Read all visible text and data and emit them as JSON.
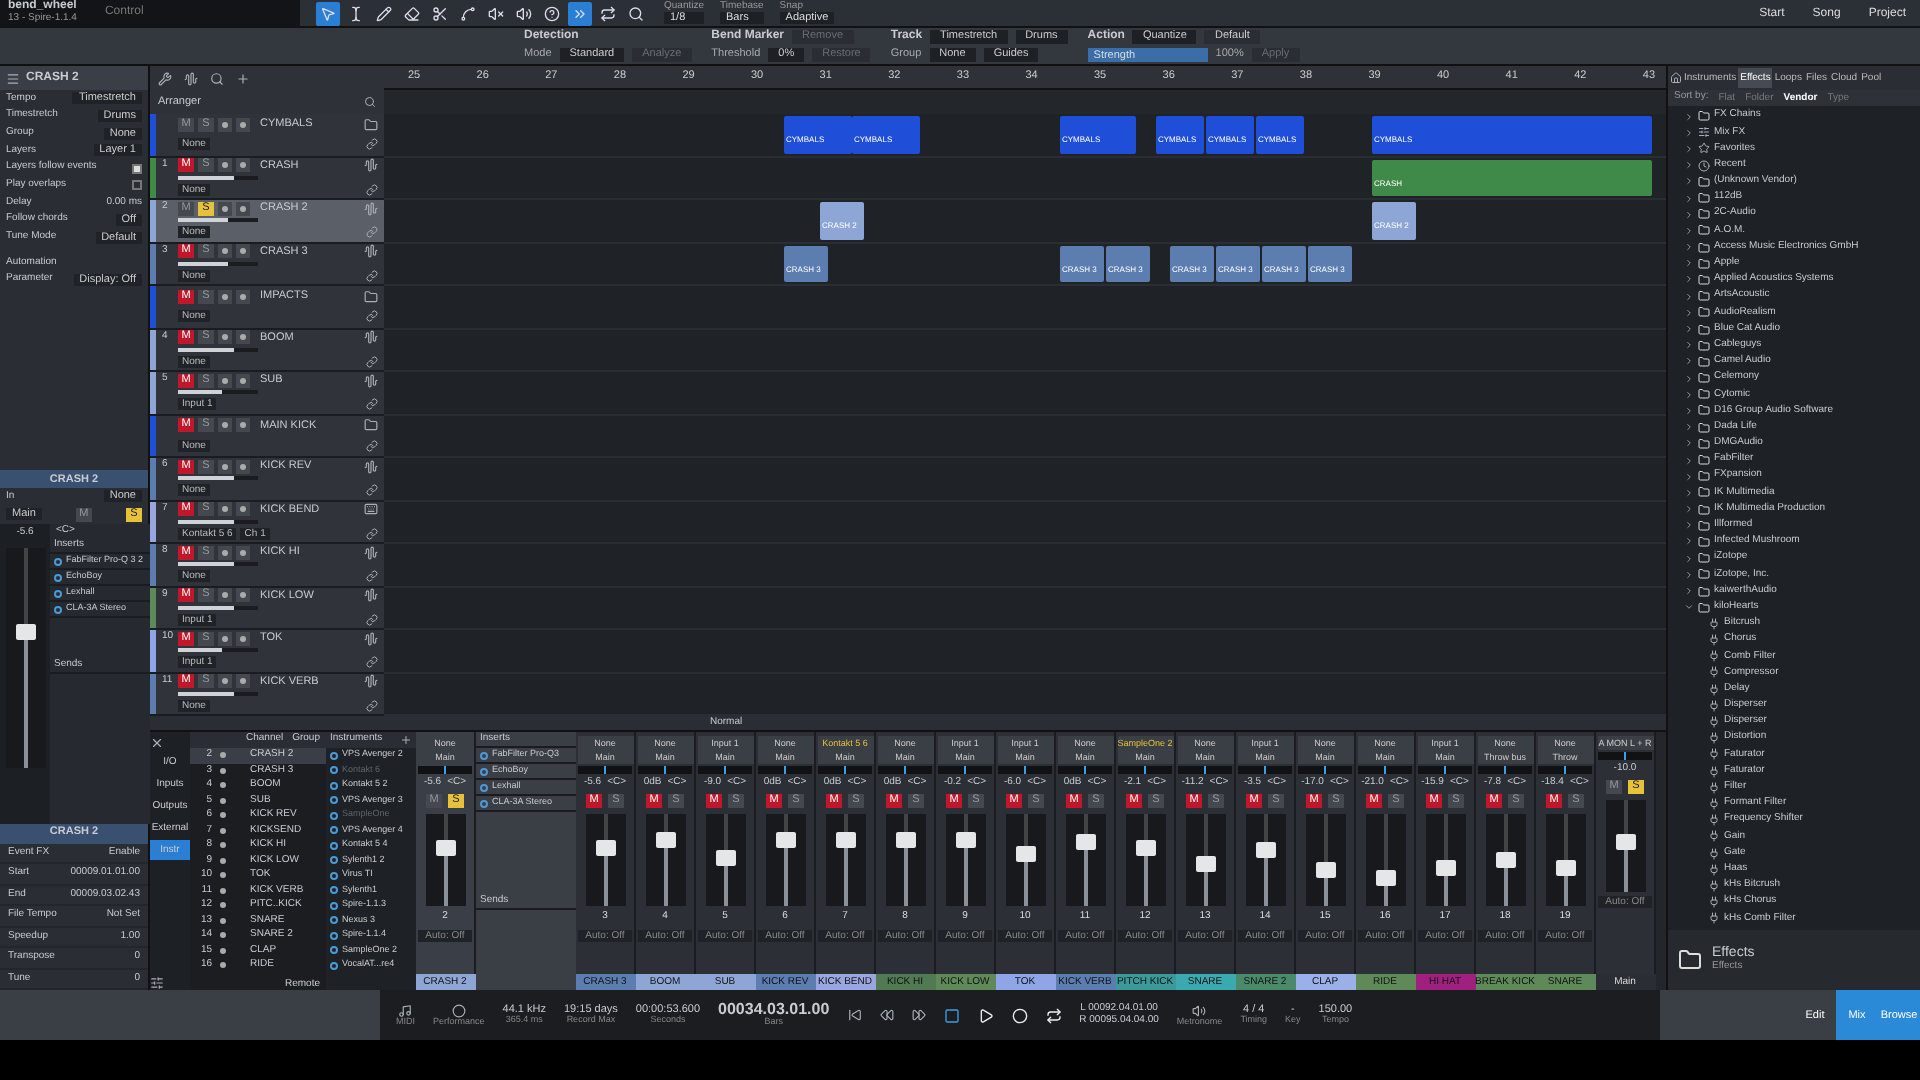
{
  "toolbar": {
    "song_title": "bend_wheel",
    "instrument": "13 - Spire-1.1.4",
    "control": "Control",
    "tools": [
      {
        "kind": "pointer",
        "selected": true
      },
      {
        "kind": "range",
        "selected": false
      },
      {
        "kind": "pencil",
        "selected": false
      },
      {
        "kind": "eraser",
        "selected": false
      },
      {
        "kind": "split",
        "selected": false
      },
      {
        "kind": "bend",
        "selected": false
      },
      {
        "kind": "mute",
        "selected": false
      },
      {
        "kind": "listen",
        "selected": false
      },
      {
        "kind": "help",
        "selected": false
      },
      {
        "kind": "autoscroll",
        "selected": true
      },
      {
        "kind": "loop",
        "selected": false
      },
      {
        "kind": "zoom",
        "selected": false
      }
    ],
    "settings": [
      {
        "label": "Quantize",
        "value": "1/8"
      },
      {
        "label": "Timebase",
        "value": "Bars"
      },
      {
        "label": "Snap",
        "value": "Adaptive"
      }
    ],
    "buttons": [
      "Start",
      "Song",
      "Project"
    ]
  },
  "bend_panel": [
    {
      "title": "Detection",
      "row2": [
        {
          "kind": "text",
          "text": "Mode"
        },
        {
          "kind": "dropdown",
          "text": "Standard"
        },
        {
          "kind": "button",
          "text": "Analyze",
          "disabled": true
        }
      ]
    },
    {
      "title": "Bend Marker",
      "row1": [
        {
          "kind": "button",
          "text": "Remove",
          "disabled": true
        }
      ],
      "row2": [
        {
          "kind": "text",
          "text": "Threshold"
        },
        {
          "kind": "dropdown",
          "text": "0%"
        },
        {
          "kind": "button",
          "text": "Restore",
          "disabled": true
        }
      ]
    },
    {
      "title": "Track",
      "row1": [
        {
          "kind": "dropdown",
          "text": "Timestretch"
        },
        {
          "kind": "dropdown",
          "text": "Drums"
        }
      ],
      "row2": [
        {
          "kind": "text",
          "text": "Group"
        },
        {
          "kind": "dropdown",
          "text": "None"
        },
        {
          "kind": "dropdown",
          "text": "Guides"
        }
      ]
    },
    {
      "title": "Action",
      "row1": [
        {
          "kind": "dropdown",
          "text": "Quantize"
        },
        {
          "kind": "button",
          "text": "Default",
          "disabled": false
        }
      ],
      "row2": [
        {
          "kind": "slider",
          "text": "Strength",
          "level": 1
        },
        {
          "kind": "text",
          "text": "100%"
        },
        {
          "kind": "button",
          "text": "Apply",
          "disabled": true
        }
      ]
    }
  ],
  "inspector": {
    "title": "CRASH 2",
    "properties": [
      {
        "kind": "dropdown",
        "label": "Tempo",
        "value": "Timestretch"
      },
      {
        "kind": "dropdown",
        "label": "Timestretch",
        "value": "Drums"
      },
      {
        "kind": "dropdown",
        "label": "Group",
        "value": "None"
      },
      {
        "kind": "dropdown",
        "label": "Layers",
        "value": "Layer 1"
      },
      {
        "kind": "check",
        "label": "Layers follow events",
        "checked": true
      },
      {
        "kind": "check",
        "label": "Play overlaps",
        "checked": false
      },
      {
        "kind": "value",
        "label": "Delay",
        "value": "0.00 ms"
      },
      {
        "kind": "dropdown",
        "label": "Follow chords",
        "value": "Off"
      },
      {
        "kind": "dropdown",
        "label": "Tune Mode",
        "value": "Default"
      }
    ],
    "automation": {
      "title": "Automation",
      "parameter": "Parameter",
      "display": "Display: Off"
    },
    "channel": {
      "name": "CRASH 2",
      "input_label": "In",
      "input": "None",
      "output": "Main",
      "volume": "-5.6",
      "pan": "<C>",
      "mute": "M",
      "solo": "S",
      "muted": false,
      "soloed": true,
      "level": 0.62,
      "inserts_title": "Inserts",
      "inserts": [
        "FabFilter Pro-Q 3 2",
        "EchoBoy",
        "Lexhall",
        "CLA-3A Stereo"
      ],
      "sends_title": "Sends"
    },
    "event": {
      "title": "CRASH 2",
      "event_fx": "Event FX",
      "enable": "Enable",
      "rows": [
        {
          "label": "Start",
          "value": "00009.01.01.00"
        },
        {
          "label": "End",
          "value": "00009.03.02.43"
        },
        {
          "label": "File Tempo",
          "value": "Not Set"
        },
        {
          "label": "Speedup",
          "value": "1.00"
        },
        {
          "label": "Transpose",
          "value": "0"
        },
        {
          "label": "Tune",
          "value": "0"
        }
      ]
    }
  },
  "arrange": {
    "header": "Arranger",
    "ruler": [
      "25",
      "26",
      "27",
      "28",
      "29",
      "30",
      "31",
      "32",
      "33",
      "34",
      "35",
      "36",
      "37",
      "38",
      "39",
      "40",
      "41",
      "42",
      "43"
    ],
    "status": "Normal",
    "tracks": [
      {
        "kind": "folder",
        "name": "CYMBALS",
        "mute": "M",
        "solo": "S",
        "muted": false,
        "soloed": false,
        "selected": false,
        "color": "#1f4fd8",
        "input": "None",
        "clips": [
          {
            "label": "CYMBALS"
          },
          {
            "label": "CYMBALS"
          },
          {
            "label": "CYMBALS"
          },
          {
            "label": "CYMBALS"
          },
          {
            "label": "CYMBALS"
          },
          {
            "label": "CYMBALS"
          },
          {
            "label": "CYMBALS"
          }
        ]
      },
      {
        "kind": "audio",
        "number": "1",
        "name": "CRASH",
        "mute": "M",
        "solo": "S",
        "muted": true,
        "soloed": false,
        "selected": false,
        "color": "#3f8a48",
        "input": "None",
        "level": 0.7,
        "clips": [
          {
            "label": "CRASH"
          }
        ]
      },
      {
        "kind": "audio",
        "number": "2",
        "name": "CRASH 2",
        "mute": "M",
        "solo": "S",
        "muted": false,
        "soloed": true,
        "selected": true,
        "color": "#8ea6d6",
        "input": "None",
        "level": 0.62,
        "clips": [
          {
            "label": "CRASH 2"
          },
          {
            "label": "CRASH 2"
          }
        ]
      },
      {
        "kind": "audio",
        "number": "3",
        "name": "CRASH 3",
        "mute": "M",
        "solo": "S",
        "muted": true,
        "soloed": false,
        "selected": false,
        "color": "#5c7db0",
        "input": "None",
        "level": 0.62,
        "clips": [
          {
            "label": "CRASH 3"
          },
          {
            "label": "CRASH 3"
          },
          {
            "label": "CRASH 3"
          },
          {
            "label": "CRASH 3"
          },
          {
            "label": "CRASH 3"
          },
          {
            "label": "CRASH 3"
          },
          {
            "label": "CRASH 3"
          }
        ]
      },
      {
        "kind": "folder",
        "name": "IMPACTS",
        "mute": "M",
        "solo": "S",
        "muted": true,
        "soloed": false,
        "selected": false,
        "color": "#1f4fd8",
        "input": "None"
      },
      {
        "kind": "audio",
        "number": "4",
        "name": "BOOM",
        "mute": "M",
        "solo": "S",
        "muted": true,
        "soloed": false,
        "selected": false,
        "color": "#8ea6d6",
        "input": "None",
        "level": 0.7
      },
      {
        "kind": "audio",
        "number": "5",
        "name": "SUB",
        "mute": "M",
        "solo": "S",
        "muted": true,
        "soloed": false,
        "selected": false,
        "color": "#8ea6d6",
        "input": "Input 1",
        "level": 0.55
      },
      {
        "kind": "folder",
        "name": "MAIN KICK",
        "mute": "M",
        "solo": "S",
        "muted": true,
        "soloed": false,
        "selected": false,
        "color": "#1f4fd8",
        "input": "None"
      },
      {
        "kind": "audio",
        "number": "6",
        "name": "KICK REV",
        "mute": "M",
        "solo": "S",
        "muted": true,
        "soloed": false,
        "selected": false,
        "color": "#5c7db0",
        "input": "None",
        "level": 0.7
      },
      {
        "kind": "instrument",
        "number": "7",
        "name": "KICK BEND",
        "mute": "M",
        "solo": "S",
        "muted": true,
        "soloed": false,
        "selected": false,
        "color": "#9aa6e0",
        "input": "Kontakt 5 6",
        "channel": "Ch 1",
        "level": 0.7
      },
      {
        "kind": "audio",
        "number": "8",
        "name": "KICK HI",
        "mute": "M",
        "solo": "S",
        "muted": true,
        "soloed": false,
        "selected": false,
        "color": "#5c7db0",
        "input": "None",
        "level": 0.7
      },
      {
        "kind": "audio",
        "number": "9",
        "name": "KICK LOW",
        "mute": "M",
        "solo": "S",
        "muted": true,
        "soloed": false,
        "selected": false,
        "color": "#5e8a5a",
        "input": "Input 1",
        "level": 0.7
      },
      {
        "kind": "audio",
        "number": "10",
        "name": "TOK",
        "mute": "M",
        "solo": "S",
        "muted": true,
        "soloed": false,
        "selected": false,
        "color": "#8ea6e8",
        "input": "Input 1",
        "level": 0.55
      },
      {
        "kind": "audio",
        "number": "11",
        "name": "KICK VERB",
        "mute": "M",
        "solo": "S",
        "muted": true,
        "soloed": false,
        "selected": false,
        "color": "#5c7db0",
        "input": "None",
        "level": 0.7
      }
    ]
  },
  "mixer": {
    "nav": [
      {
        "label": "I/O",
        "selected": false
      },
      {
        "label": "Inputs",
        "selected": false
      },
      {
        "label": "Outputs",
        "selected": false
      },
      {
        "label": "External",
        "selected": false
      },
      {
        "label": "Instr",
        "selected": true
      }
    ],
    "remote": "Remote",
    "channel_header": "Channel",
    "group_header": "Group",
    "channel_list": [
      {
        "number": "2",
        "name": "CRASH 2",
        "selected": true
      },
      {
        "number": "3",
        "name": "CRASH 3",
        "selected": false
      },
      {
        "number": "4",
        "name": "BOOM",
        "selected": false
      },
      {
        "number": "5",
        "name": "SUB",
        "selected": false
      },
      {
        "number": "6",
        "name": "KICK REV",
        "selected": false
      },
      {
        "number": "7",
        "name": "KICKSEND",
        "selected": false
      },
      {
        "number": "8",
        "name": "KICK HI",
        "selected": false
      },
      {
        "number": "9",
        "name": "KICK LOW",
        "selected": false
      },
      {
        "number": "10",
        "name": "TOK",
        "selected": false
      },
      {
        "number": "11",
        "name": "KICK VERB",
        "selected": false
      },
      {
        "number": "12",
        "name": "PITC..KICK",
        "selected": false
      },
      {
        "number": "13",
        "name": "SNARE",
        "selected": false
      },
      {
        "number": "14",
        "name": "SNARE 2",
        "selected": false
      },
      {
        "number": "15",
        "name": "CLAP",
        "selected": false
      },
      {
        "number": "16",
        "name": "RIDE",
        "selected": false
      }
    ],
    "instruments_header": "Instruments",
    "instruments": [
      {
        "name": "VPS Avenger 2",
        "enabled": true
      },
      {
        "name": "Kontakt 6",
        "enabled": false
      },
      {
        "name": "Kontakt 5 2",
        "enabled": true
      },
      {
        "name": "VPS Avenger 3",
        "enabled": true
      },
      {
        "name": "SampleOne",
        "enabled": false
      },
      {
        "name": "VPS Avenger 4",
        "enabled": true
      },
      {
        "name": "Kontakt 5 4",
        "enabled": true
      },
      {
        "name": "Sylenth1 2",
        "enabled": true
      },
      {
        "name": "Virus TI",
        "enabled": true
      },
      {
        "name": "Sylenth1",
        "enabled": true
      },
      {
        "name": "Spire-1.1.3",
        "enabled": true
      },
      {
        "name": "Nexus 3",
        "enabled": true
      },
      {
        "name": "Spire-1.1.4",
        "enabled": true
      },
      {
        "name": "SampleOne 2",
        "enabled": true
      },
      {
        "name": "VocalAT...re4",
        "enabled": true
      }
    ],
    "channels": [
      {
        "kind": "channel",
        "number": "2",
        "name": "CRASH 2",
        "color": "#8ea6d6",
        "input": "None",
        "output": "Main",
        "volume": "-5.6",
        "pan": "<C>",
        "mute": "M",
        "solo": "S",
        "muted": false,
        "soloed": true,
        "level": 0.62,
        "auto": "Auto: Off",
        "selected": true
      },
      {
        "kind": "inserts",
        "title": "Inserts",
        "items": [
          "FabFilter Pro-Q3",
          "EchoBoy",
          "Lexhall",
          "CLA-3A Stereo"
        ],
        "sends": "Sends"
      },
      {
        "kind": "channel",
        "number": "3",
        "name": "CRASH 3",
        "color": "#5c7db0",
        "input": "None",
        "output": "Main",
        "volume": "-5.6",
        "pan": "<C>",
        "mute": "M",
        "solo": "S",
        "muted": true,
        "soloed": false,
        "level": 0.62,
        "auto": "Auto: Off",
        "selected": false
      },
      {
        "kind": "channel",
        "number": "4",
        "name": "BOOM",
        "color": "#8ea6d6",
        "input": "None",
        "output": "Main",
        "volume": "0dB",
        "pan": "<C>",
        "mute": "M",
        "solo": "S",
        "muted": true,
        "soloed": false,
        "level": 0.72,
        "auto": "Auto: Off",
        "selected": false
      },
      {
        "kind": "channel",
        "number": "5",
        "name": "SUB",
        "color": "#8ea6d6",
        "input": "Input 1",
        "output": "Main",
        "volume": "-9.0",
        "pan": "<C>",
        "mute": "M",
        "solo": "S",
        "muted": true,
        "soloed": false,
        "level": 0.52,
        "auto": "Auto: Off",
        "selected": false
      },
      {
        "kind": "channel",
        "number": "6",
        "name": "KICK REV",
        "color": "#5c7db0",
        "input": "None",
        "output": "Main",
        "volume": "0dB",
        "pan": "<C>",
        "mute": "M",
        "solo": "S",
        "muted": true,
        "soloed": false,
        "level": 0.72,
        "auto": "Auto: Off",
        "selected": false
      },
      {
        "kind": "channel",
        "number": "7",
        "name": "KICK BEND",
        "color": "#9aa6e0",
        "input": "Kontakt 5 6",
        "output": "Main",
        "volume": "0dB",
        "pan": "<C>",
        "mute": "M",
        "solo": "S",
        "muted": true,
        "soloed": false,
        "level": 0.72,
        "auto": "Auto: Off",
        "selected": false
      },
      {
        "kind": "channel",
        "number": "8",
        "name": "KICK HI",
        "color": "#4f7a52",
        "input": "None",
        "output": "Main",
        "volume": "0dB",
        "pan": "<C>",
        "mute": "M",
        "solo": "S",
        "muted": true,
        "soloed": false,
        "level": 0.72,
        "auto": "Auto: Off",
        "selected": false
      },
      {
        "kind": "channel",
        "number": "9",
        "name": "KICK LOW",
        "color": "#5e8a5a",
        "input": "Input 1",
        "output": "Main",
        "volume": "-0.2",
        "pan": "<C>",
        "mute": "M",
        "solo": "S",
        "muted": true,
        "soloed": false,
        "level": 0.72,
        "auto": "Auto: Off",
        "selected": false
      },
      {
        "kind": "channel",
        "number": "10",
        "name": "TOK",
        "color": "#8ea6e8",
        "input": "Input 1",
        "output": "Main",
        "volume": "-6.0",
        "pan": "<C>",
        "mute": "M",
        "solo": "S",
        "muted": true,
        "soloed": false,
        "level": 0.56,
        "auto": "Auto: Off",
        "selected": false
      },
      {
        "kind": "channel",
        "number": "11",
        "name": "KICK VERB",
        "color": "#5c7db0",
        "input": "None",
        "output": "Main",
        "volume": "0dB",
        "pan": "<C>",
        "mute": "M",
        "solo": "S",
        "muted": true,
        "soloed": false,
        "level": 0.7,
        "auto": "Auto: Off",
        "selected": false
      },
      {
        "kind": "channel",
        "number": "12",
        "name": "PITCH KICK",
        "color": "#3a9a9a",
        "input": "SampleOne 2",
        "output": "Main",
        "volume": "-2.1",
        "pan": "<C>",
        "mute": "M",
        "solo": "S",
        "muted": true,
        "soloed": false,
        "level": 0.64,
        "auto": "Auto: Off",
        "selected": false
      },
      {
        "kind": "channel",
        "number": "13",
        "name": "SNARE",
        "color": "#3aaab0",
        "input": "None",
        "output": "Main",
        "volume": "-11.2",
        "pan": "<C>",
        "mute": "M",
        "solo": "S",
        "muted": true,
        "soloed": false,
        "level": 0.45,
        "auto": "Auto: Off",
        "selected": false
      },
      {
        "kind": "channel",
        "number": "14",
        "name": "SNARE 2",
        "color": "#4a8a6a",
        "input": "Input 1",
        "output": "Main",
        "volume": "-3.5",
        "pan": "<C>",
        "mute": "M",
        "solo": "S",
        "muted": true,
        "soloed": false,
        "level": 0.6,
        "auto": "Auto: Off",
        "selected": false
      },
      {
        "kind": "channel",
        "number": "15",
        "name": "CLAP",
        "color": "#9ab0e8",
        "input": "None",
        "output": "Main",
        "volume": "-17.0",
        "pan": "<C>",
        "mute": "M",
        "solo": "S",
        "muted": true,
        "soloed": false,
        "level": 0.4,
        "auto": "Auto: Off",
        "selected": false
      },
      {
        "kind": "channel",
        "number": "16",
        "name": "RIDE",
        "color": "#5e8a5a",
        "input": "None",
        "output": "Main",
        "volume": "-21.0",
        "pan": "<C>",
        "mute": "M",
        "solo": "S",
        "muted": true,
        "soloed": false,
        "level": 0.3,
        "auto": "Auto: Off",
        "selected": false
      },
      {
        "kind": "channel",
        "number": "17",
        "name": "HI HAT",
        "color": "#a02080",
        "input": "Input 1",
        "output": "Main",
        "volume": "-15.9",
        "pan": "<C>",
        "mute": "M",
        "solo": "S",
        "muted": true,
        "soloed": false,
        "level": 0.42,
        "auto": "Auto: Off",
        "selected": false
      },
      {
        "kind": "channel",
        "number": "18",
        "name": "BREAK KICK",
        "color": "#5e8a5a",
        "input": "None",
        "output": "Throw bus",
        "volume": "-7.8",
        "pan": "<C>",
        "mute": "M",
        "solo": "S",
        "muted": true,
        "soloed": false,
        "level": 0.5,
        "auto": "Auto: Off",
        "selected": false
      },
      {
        "kind": "channel",
        "number": "19",
        "name": "SNARE",
        "color": "#5e8a5a",
        "input": "None",
        "output": "Throw",
        "volume": "-18.4",
        "pan": "<C>",
        "mute": "M",
        "solo": "S",
        "muted": true,
        "soloed": false,
        "level": 0.42,
        "auto": "Auto: Off",
        "selected": false
      },
      {
        "kind": "main",
        "name": "Main",
        "color": "#2a2d33",
        "input": "A MON L + R",
        "volume": "-10.0",
        "mute": "M",
        "solo": "S",
        "muted": false,
        "soloed": true,
        "level": 0.55,
        "auto": "Auto: Off",
        "selected": false
      }
    ]
  },
  "browser": {
    "tabs": [
      {
        "label": "Instruments",
        "selected": false
      },
      {
        "label": "Effects",
        "selected": true
      },
      {
        "label": "Loops",
        "selected": false
      },
      {
        "label": "Files",
        "selected": false
      },
      {
        "label": "Cloud",
        "selected": false
      },
      {
        "label": "Pool",
        "selected": false
      }
    ],
    "sort_label": "Sort by:",
    "sort_options": [
      {
        "label": "Flat",
        "selected": false
      },
      {
        "label": "Folder",
        "selected": false
      },
      {
        "label": "Vendor",
        "selected": true
      },
      {
        "label": "Type",
        "selected": false
      }
    ],
    "tree": [
      {
        "kind": "chains",
        "name": "FX Chains",
        "expanded": false
      },
      {
        "kind": "mix",
        "name": "Mix FX",
        "expanded": false
      },
      {
        "kind": "favorites",
        "name": "Favorites",
        "expanded": false
      },
      {
        "kind": "recent",
        "name": "Recent",
        "expanded": false
      },
      {
        "kind": "folder",
        "name": "(Unknown Vendor)",
        "expanded": false
      },
      {
        "kind": "folder",
        "name": "112dB",
        "expanded": false
      },
      {
        "kind": "folder",
        "name": "2C-Audio",
        "expanded": false
      },
      {
        "kind": "folder",
        "name": "A.O.M.",
        "expanded": false
      },
      {
        "kind": "folder",
        "name": "Access Music Electronics GmbH",
        "expanded": false
      },
      {
        "kind": "folder",
        "name": "Apple",
        "expanded": false
      },
      {
        "kind": "folder",
        "name": "Applied Acoustics Systems",
        "expanded": false
      },
      {
        "kind": "folder",
        "name": "ArtsAcoustic",
        "expanded": false
      },
      {
        "kind": "folder",
        "name": "AudioRealism",
        "expanded": false
      },
      {
        "kind": "folder",
        "name": "Blue Cat Audio",
        "expanded": false
      },
      {
        "kind": "folder",
        "name": "Cableguys",
        "expanded": false
      },
      {
        "kind": "folder",
        "name": "Camel Audio",
        "expanded": false
      },
      {
        "kind": "folder",
        "name": "Celemony",
        "expanded": false
      },
      {
        "kind": "folder",
        "name": "Cytomic",
        "expanded": false
      },
      {
        "kind": "folder",
        "name": "D16 Group Audio Software",
        "expanded": false
      },
      {
        "kind": "folder",
        "name": "Dada Life",
        "expanded": false
      },
      {
        "kind": "folder",
        "name": "DMGAudio",
        "expanded": false
      },
      {
        "kind": "folder",
        "name": "FabFilter",
        "expanded": false
      },
      {
        "kind": "folder",
        "name": "FXpansion",
        "expanded": false
      },
      {
        "kind": "folder",
        "name": "IK Multimedia",
        "expanded": false
      },
      {
        "kind": "folder",
        "name": "IK Multimedia Production",
        "expanded": false
      },
      {
        "kind": "folder",
        "name": "Illformed",
        "expanded": false
      },
      {
        "kind": "folder",
        "name": "Infected Mushroom",
        "expanded": false
      },
      {
        "kind": "folder",
        "name": "iZotope",
        "expanded": false
      },
      {
        "kind": "folder",
        "name": "iZotope, Inc.",
        "expanded": false
      },
      {
        "kind": "folder",
        "name": "kaiwerthAudio",
        "expanded": false
      },
      {
        "kind": "folder",
        "name": "kiloHearts",
        "expanded": true,
        "children": [
          {
            "kind": "plugin",
            "name": "Bitcrush"
          },
          {
            "kind": "plugin",
            "name": "Chorus"
          },
          {
            "kind": "plugin",
            "name": "Comb Filter"
          },
          {
            "kind": "plugin",
            "name": "Compressor"
          },
          {
            "kind": "plugin",
            "name": "Delay"
          },
          {
            "kind": "plugin",
            "name": "Disperser"
          },
          {
            "kind": "plugin",
            "name": "Disperser"
          },
          {
            "kind": "plugin",
            "name": "Distortion"
          },
          {
            "kind": "plugin",
            "name": "Faturator"
          },
          {
            "kind": "plugin",
            "name": "Faturator"
          },
          {
            "kind": "plugin",
            "name": "Filter"
          },
          {
            "kind": "plugin",
            "name": "Formant Filter"
          },
          {
            "kind": "plugin",
            "name": "Frequency Shifter"
          },
          {
            "kind": "plugin",
            "name": "Gain"
          },
          {
            "kind": "plugin",
            "name": "Gate"
          },
          {
            "kind": "plugin",
            "name": "Haas"
          },
          {
            "kind": "plugin",
            "name": "kHs Bitcrush"
          },
          {
            "kind": "plugin",
            "name": "kHs Chorus"
          },
          {
            "kind": "plugin",
            "name": "kHs Comb Filter"
          }
        ]
      }
    ],
    "footer": {
      "title": "Effects",
      "subtitle": "Effects"
    }
  },
  "transport": {
    "readouts": [
      {
        "label": "MIDI"
      },
      {
        "label": "Performance"
      },
      {
        "value": "44.1 kHz",
        "label": "365.4 ms"
      },
      {
        "value": "19:15 days",
        "label": "Record Max"
      },
      {
        "value": "00:00:53.600",
        "label": "Seconds"
      }
    ],
    "position": {
      "value": "00034.03.01.00",
      "label": "Bars"
    },
    "loop": [
      {
        "prefix": "L",
        "value": "00092.04.01.00"
      },
      {
        "prefix": "R",
        "value": "00095.04.04.00"
      }
    ],
    "right": [
      {
        "label": "Metronome"
      },
      {
        "value": "4 / 4",
        "label": "Timing"
      },
      {
        "value": "-",
        "label": "Key"
      },
      {
        "value": "150.00",
        "label": "Tempo"
      }
    ],
    "views": [
      {
        "label": "Edit",
        "selected": false
      },
      {
        "label": "Mix",
        "selected": true
      },
      {
        "label": "Browse",
        "selected": true
      }
    ]
  }
}
